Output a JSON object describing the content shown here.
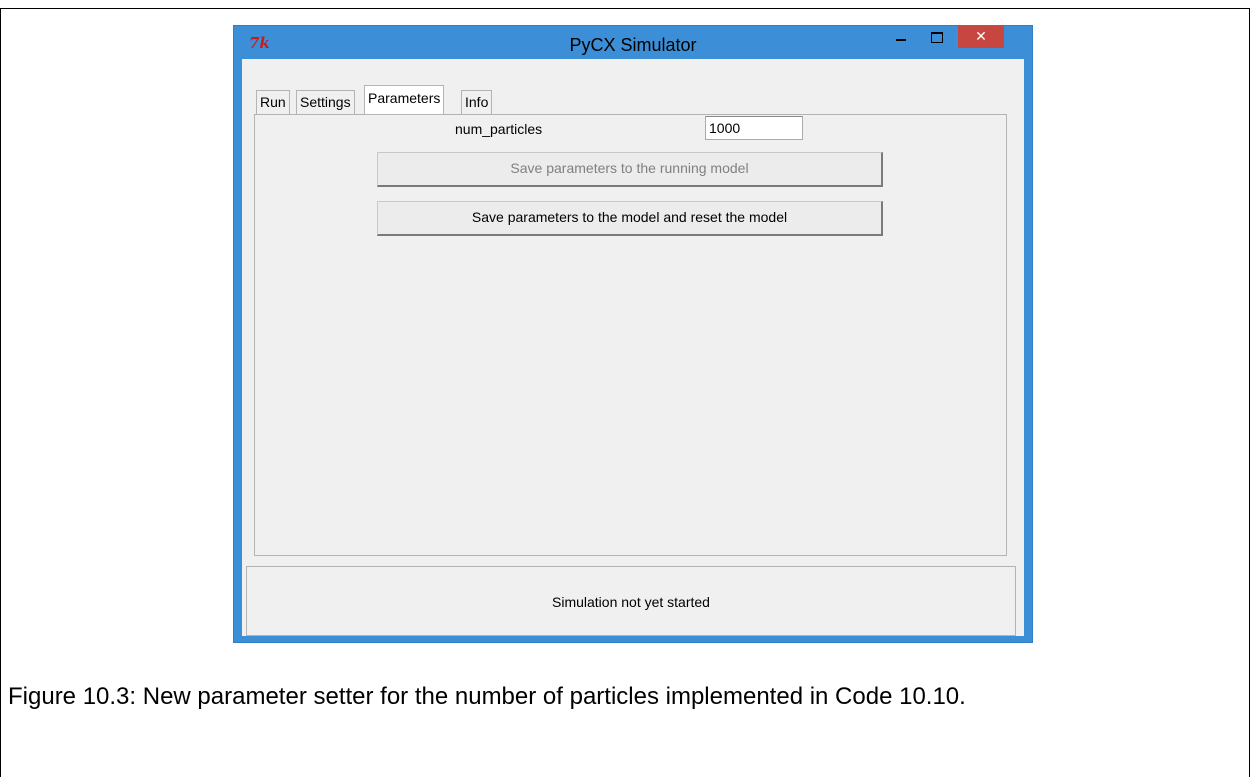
{
  "window": {
    "title": "PyCX Simulator",
    "logo_text": "7k",
    "close_glyph": "✕"
  },
  "tabs": [
    {
      "label": "Run"
    },
    {
      "label": "Settings"
    },
    {
      "label": "Parameters",
      "active": true
    },
    {
      "label": "Info"
    }
  ],
  "parameters": {
    "field_label": "num_particles",
    "field_value": "1000",
    "save_running_label": "Save parameters to the running model",
    "save_reset_label": "Save parameters to the model and reset the model"
  },
  "status": {
    "text": "Simulation not yet started"
  },
  "caption": {
    "text": "Figure 10.3: New parameter setter for the number of particles implemented in Code 10.10."
  },
  "colors": {
    "titlebar": "#3c8fd6",
    "close_button": "#c7463f",
    "panel_bg": "#f0f0f0"
  }
}
